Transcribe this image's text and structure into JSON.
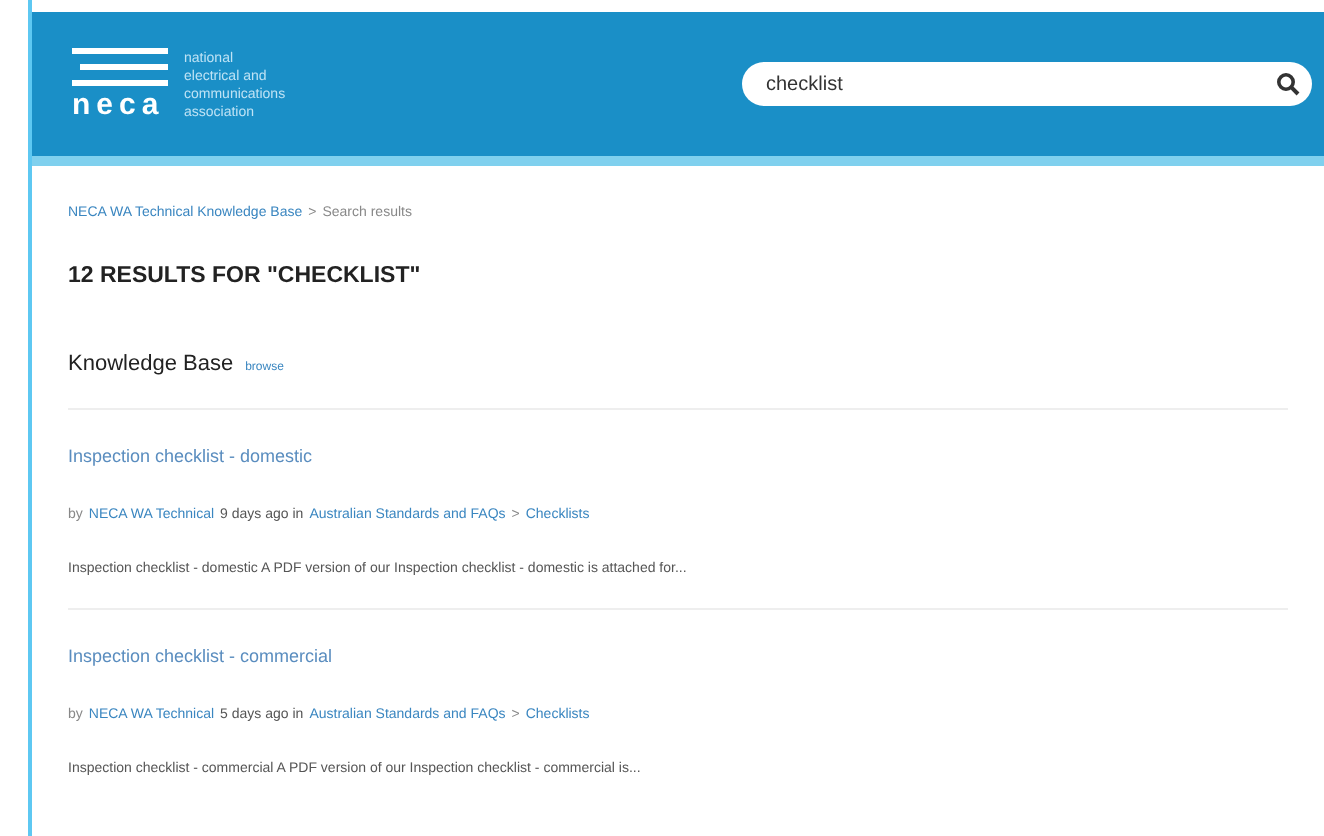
{
  "logo": {
    "wordmark": "neca",
    "tagline": [
      "national",
      "electrical and",
      "communications",
      "association"
    ]
  },
  "search": {
    "value": "checklist"
  },
  "breadcrumb": [
    {
      "label": "NECA WA Technical Knowledge Base",
      "kind": "link"
    },
    {
      "label": ">",
      "kind": "separator"
    },
    {
      "label": "Search results",
      "kind": "current"
    }
  ],
  "heading": "12 RESULTS FOR \"CHECKLIST\"",
  "section": {
    "title": "Knowledge Base",
    "link": "browse"
  },
  "results": [
    {
      "title": "Inspection checklist - domestic",
      "by": "by",
      "author": "NECA WA Technical",
      "age": "9 days ago in",
      "category": "Australian Standards and FAQs",
      "separator": ">",
      "subcategory": "Checklists",
      "snippet": "Inspection checklist - domestic   A PDF version of our Inspection checklist - domestic is attached for..."
    },
    {
      "title": "Inspection checklist - commercial",
      "by": "by",
      "author": "NECA WA Technical",
      "age": "5 days ago in",
      "category": "Australian Standards and FAQs",
      "separator": ">",
      "subcategory": "Checklists",
      "snippet": "Inspection checklist - commercial   A PDF version of our Inspection checklist - commercial is..."
    }
  ]
}
